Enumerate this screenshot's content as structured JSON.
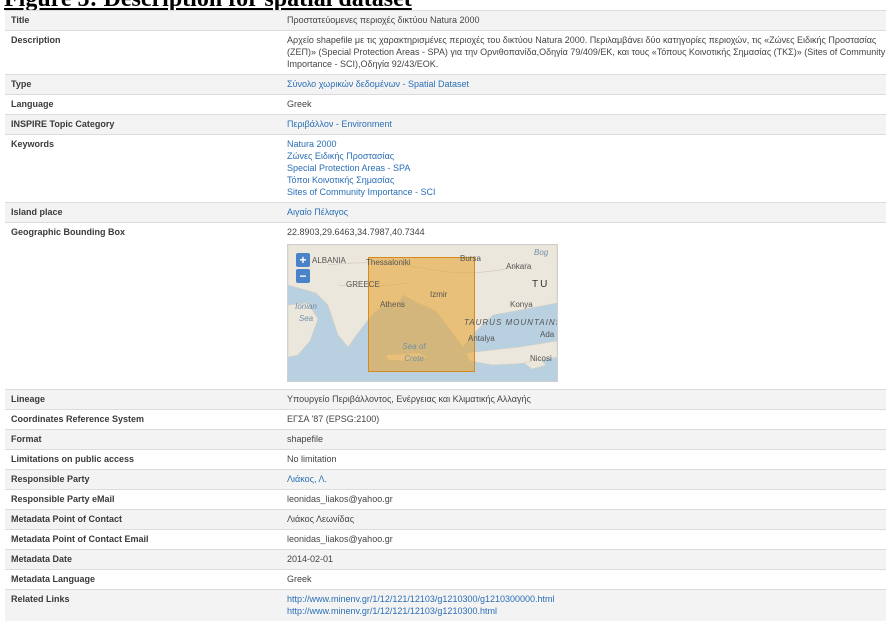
{
  "heading": "Figure 5: Description for spatial dataset",
  "rows": [
    {
      "label": "Title",
      "values": [
        "Προστατεύομενες περιοχές δικτύου Natura 2000"
      ]
    },
    {
      "label": "Description",
      "values": [
        "Αρχείο shapefile με τις χαρακτηρισμένες περιοχές του δικτύου Natura 2000. Περιλαμβάνει δύο κατηγορίες περιοχών, τις «Ζώνες Ειδικής Προστασίας (ΖΕΠ)» (Special Protection Areas - SPA) για την Ορνιθοπανίδα,Οδηγία 79/409/ΕΚ, και τους «Τόπους Κοινοτικής Σημασίας (ΤΚΣ)» (Sites of Community Importance - SCI),Οδηγία 92/43/ΕΟΚ."
      ]
    },
    {
      "label": "Type",
      "values": [
        "Σύνολο χωρικών δεδομένων - Spatial Dataset"
      ]
    },
    {
      "label": "Language",
      "values": [
        "Greek"
      ]
    },
    {
      "label": "INSPIRE Topic Category",
      "values": [
        "Περιβάλλον - Environment"
      ]
    },
    {
      "label": "Keywords",
      "values": [
        "Natura 2000",
        "Ζώνες Ειδικής Προστασίας",
        "Special Protection Areas - SPA",
        "Τόποι Κοινοτικής Σημασίας",
        "Sites of Community Importance - SCI"
      ]
    },
    {
      "label": "Island place",
      "values": [
        "Αιγαίο Πέλαγος"
      ]
    },
    {
      "label": "Geographic Bounding Box",
      "values": [
        "22.8903,29.6463,34.7987,40.7344"
      ]
    },
    {
      "label": "Lineage",
      "values": [
        "Υπουργείο Περιβάλλοντος, Ενέργειας και Κλιματικής Αλλαγής"
      ]
    },
    {
      "label": "Coordinates Reference System",
      "values": [
        "ΕΓΣΑ '87 (EPSG:2100)"
      ]
    },
    {
      "label": "Format",
      "values": [
        "shapefile"
      ]
    },
    {
      "label": "Limitations on public access",
      "values": [
        "No limitation"
      ]
    },
    {
      "label": "Responsible Party",
      "values": [
        "Λιάκος, Λ."
      ]
    },
    {
      "label": "Responsible Party eMail",
      "values": [
        "leonidas_liakos@yahoo.gr"
      ]
    },
    {
      "label": "Metadata Point of Contact",
      "values": [
        "Λιάκος Λεωνίδας"
      ]
    },
    {
      "label": "Metadata Point of Contact Email",
      "values": [
        "leonidas_liakos@yahoo.gr"
      ]
    },
    {
      "label": "Metadata Date",
      "values": [
        "2014-02-01"
      ]
    },
    {
      "label": "Metadata Language",
      "values": [
        "Greek"
      ]
    },
    {
      "label": "Related Links",
      "values": [
        "http://www.minenv.gr/1/12/121/12103/g1210300/g1210300000.html",
        "http://www.minenv.gr/1/12/121/12103/g1210300.html"
      ]
    }
  ],
  "map": {
    "zoom_in": "+",
    "zoom_out": "−",
    "labels": [
      "ALBANIA",
      "Thessaloniki",
      "Bursa",
      "Ankara",
      "GREECE",
      "TU",
      "Izmir",
      "Ionian Sea",
      "Athens",
      "Konya",
      "TAURUS MOUNTAINS",
      "Antalya",
      "Ada",
      "Sea of Crete",
      "Nicosi",
      "Bog"
    ]
  },
  "colors": {
    "link": "#2a6fb6",
    "row_alt": "#f3f3f3",
    "bbox_fill": "#e8a028",
    "zoom_button": "#4a83c7",
    "sea": "#b8d0e0",
    "land": "#ece7dc"
  }
}
